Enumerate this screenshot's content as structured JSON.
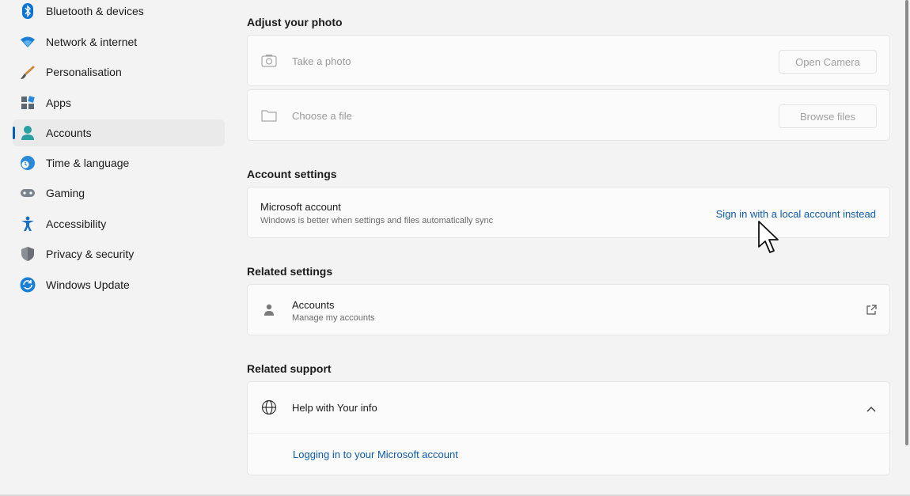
{
  "sidebar": {
    "items": [
      {
        "label": "Bluetooth & devices",
        "icon": "bluetooth-icon"
      },
      {
        "label": "Network & internet",
        "icon": "wifi-icon"
      },
      {
        "label": "Personalisation",
        "icon": "brush-icon"
      },
      {
        "label": "Apps",
        "icon": "apps-icon"
      },
      {
        "label": "Accounts",
        "icon": "person-icon",
        "active": true
      },
      {
        "label": "Time & language",
        "icon": "globe-clock-icon"
      },
      {
        "label": "Gaming",
        "icon": "gamepad-icon"
      },
      {
        "label": "Accessibility",
        "icon": "accessibility-icon"
      },
      {
        "label": "Privacy & security",
        "icon": "shield-icon"
      },
      {
        "label": "Windows Update",
        "icon": "update-icon"
      }
    ]
  },
  "adjust_photo": {
    "title": "Adjust your photo",
    "take_photo_label": "Take a photo",
    "open_camera_label": "Open Camera",
    "choose_file_label": "Choose a file",
    "browse_files_label": "Browse files"
  },
  "account_settings": {
    "title": "Account settings",
    "ms_account_title": "Microsoft account",
    "ms_account_desc": "Windows is better when settings and files automatically sync",
    "local_account_link": "Sign in with a local account instead"
  },
  "related_settings": {
    "title": "Related settings",
    "accounts_title": "Accounts",
    "accounts_desc": "Manage my accounts"
  },
  "related_support": {
    "title": "Related support",
    "help_title": "Help with Your info",
    "help_link": "Logging in to your Microsoft account"
  },
  "colors": {
    "accent": "#005fb8",
    "link": "#0f5aa8",
    "background": "#f3f3f3",
    "card": "#fbfbfb"
  }
}
